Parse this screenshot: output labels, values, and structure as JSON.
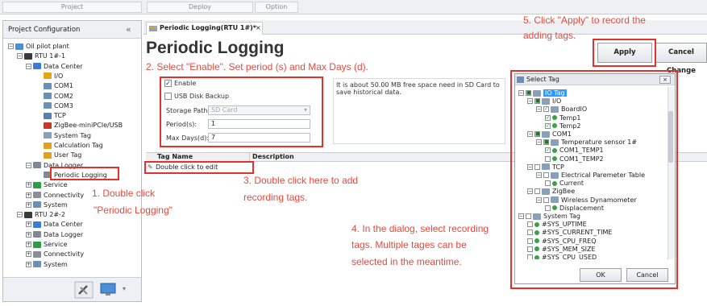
{
  "topbar": {
    "project": "Project",
    "deploy": "Deploy",
    "option": "Option"
  },
  "left": {
    "header": "Project Configuration",
    "collapse_glyph": "«",
    "tree": [
      {
        "label": "Oil pilot plant",
        "depth": 0,
        "icon": "project-icon",
        "color": "#4a90d9"
      },
      {
        "label": "RTU 1#-1",
        "depth": 1,
        "icon": "device-icon",
        "color": "#3a3a3a"
      },
      {
        "label": "Data Center",
        "depth": 2,
        "icon": "data-center-icon",
        "color": "#3a7bd5"
      },
      {
        "label": "I/O",
        "depth": 3,
        "icon": "io-icon",
        "color": "#e8a316"
      },
      {
        "label": "COM1",
        "depth": 3,
        "icon": "com-icon",
        "color": "#6b8fb5"
      },
      {
        "label": "COM2",
        "depth": 3,
        "icon": "com-icon",
        "color": "#6b8fb5"
      },
      {
        "label": "COM3",
        "depth": 3,
        "icon": "com-icon",
        "color": "#6b8fb5"
      },
      {
        "label": "TCP",
        "depth": 3,
        "icon": "tcp-icon",
        "color": "#5a7fa8"
      },
      {
        "label": "ZigBee-miniPCIe/USB",
        "depth": 3,
        "icon": "zigbee-icon",
        "color": "#c0392b"
      },
      {
        "label": "System Tag",
        "depth": 3,
        "icon": "system-tag-icon",
        "color": "#8aa0b8"
      },
      {
        "label": "Calculation Tag",
        "depth": 3,
        "icon": "calculation-tag-icon",
        "color": "#e0a020"
      },
      {
        "label": "User Tag",
        "depth": 3,
        "icon": "user-tag-icon",
        "color": "#e0a020"
      },
      {
        "label": "Data Logger",
        "depth": 2,
        "icon": "data-logger-icon",
        "color": "#7d8a96"
      },
      {
        "label": "Periodic Logging",
        "depth": 3,
        "icon": "periodic-logging-icon",
        "color": "#7d8a96"
      },
      {
        "label": "Service",
        "depth": 2,
        "icon": "service-icon",
        "color": "#2e9b45"
      },
      {
        "label": "Connectivity",
        "depth": 2,
        "icon": "connectivity-icon",
        "color": "#8a8f96"
      },
      {
        "label": "System",
        "depth": 2,
        "icon": "system-icon",
        "color": "#6b8fb5"
      },
      {
        "label": "RTU 2#-2",
        "depth": 1,
        "icon": "device-icon",
        "color": "#3a3a3a"
      },
      {
        "label": "Data Center",
        "depth": 2,
        "icon": "data-center-icon",
        "color": "#3a7bd5"
      },
      {
        "label": "Data Logger",
        "depth": 2,
        "icon": "data-logger-icon",
        "color": "#7d8a96"
      },
      {
        "label": "Service",
        "depth": 2,
        "icon": "service-icon",
        "color": "#2e9b45"
      },
      {
        "label": "Connectivity",
        "depth": 2,
        "icon": "connectivity-icon",
        "color": "#8a8f96"
      },
      {
        "label": "System",
        "depth": 2,
        "icon": "system-icon",
        "color": "#6b8fb5"
      }
    ]
  },
  "tab": {
    "label": "Periodic Logging(RTU 1#)*",
    "close": "×"
  },
  "page": {
    "title": "Periodic Logging"
  },
  "buttons": {
    "apply": "Apply",
    "cancel_change": "Cancel Change"
  },
  "form": {
    "enable_label": "Enable",
    "usb_label": "USB Disk Backup",
    "storage_path_label": "Storage Path:",
    "storage_path_value": "SD Card",
    "period_label": "Period(s):",
    "period_value": "1",
    "max_days_label": "Max Days(d):",
    "max_days_value": "7"
  },
  "info_text": "It is about 50.00 MB free space need in SD Card to save historical data.",
  "grid": {
    "col_tag_name": "Tag Name",
    "col_description": "Description",
    "row_placeholder": "Double click to edit"
  },
  "annotations": {
    "step1_line1": "1. Double click",
    "step1_line2": "\"Periodic Logging\"",
    "step2": "2. Select \"Enable\". Set period (s) and Max Days (d).",
    "step3_line1": "3. Double click here to add",
    "step3_line2": "recording tags.",
    "step4_line1": "4. In the dialog, select recording",
    "step4_line2": "tags. Multiple tages can be",
    "step4_line3": "selected in the meantime.",
    "step5_line1": "5. Click \"Apply\" to record the",
    "step5_line2": "adding tags."
  },
  "dialog": {
    "title": "Select Tag",
    "close": "×",
    "ok": "OK",
    "cancel": "Cancel",
    "tree": [
      {
        "label": "IO Tag",
        "depth": 0,
        "checked": "partial",
        "selected": true
      },
      {
        "label": "I/O",
        "depth": 1,
        "checked": "partial"
      },
      {
        "label": "BoardIO",
        "depth": 2,
        "checked": "true"
      },
      {
        "label": "Temp1",
        "depth": 3,
        "checked": "true",
        "tag": true
      },
      {
        "label": "Temp2",
        "depth": 3,
        "checked": "true",
        "tag": true
      },
      {
        "label": "COM1",
        "depth": 1,
        "checked": "partial"
      },
      {
        "label": "Temperature sensor 1#",
        "depth": 2,
        "checked": "partial"
      },
      {
        "label": "COM1_TEMP1",
        "depth": 3,
        "checked": "true",
        "tag": true
      },
      {
        "label": "COM1_TEMP2",
        "depth": 3,
        "checked": "false",
        "tag": true
      },
      {
        "label": "TCP",
        "depth": 1,
        "checked": "false"
      },
      {
        "label": "Electrical Paremeter Table",
        "depth": 2,
        "checked": "false"
      },
      {
        "label": "Current",
        "depth": 3,
        "checked": "false",
        "tag": true
      },
      {
        "label": "ZigBee",
        "depth": 1,
        "checked": "false"
      },
      {
        "label": "Wireless Dynamometer",
        "depth": 2,
        "checked": "false"
      },
      {
        "label": "Displacement",
        "depth": 3,
        "checked": "false",
        "tag": true
      },
      {
        "label": "System Tag",
        "depth": 0,
        "checked": "false"
      },
      {
        "label": "#SYS_UPTIME",
        "depth": 1,
        "checked": "false",
        "tag": true
      },
      {
        "label": "#SYS_CURRENT_TIME",
        "depth": 1,
        "checked": "false",
        "tag": true
      },
      {
        "label": "#SYS_CPU_FREQ",
        "depth": 1,
        "checked": "false",
        "tag": true
      },
      {
        "label": "#SYS_MEM_SIZE",
        "depth": 1,
        "checked": "false",
        "tag": true
      },
      {
        "label": "#SYS_CPU_USED",
        "depth": 1,
        "checked": "false",
        "tag": true
      }
    ]
  },
  "colors": {
    "annotation": "#e8493d",
    "highlight_box": "#e5312a",
    "selection": "#3399ff"
  }
}
